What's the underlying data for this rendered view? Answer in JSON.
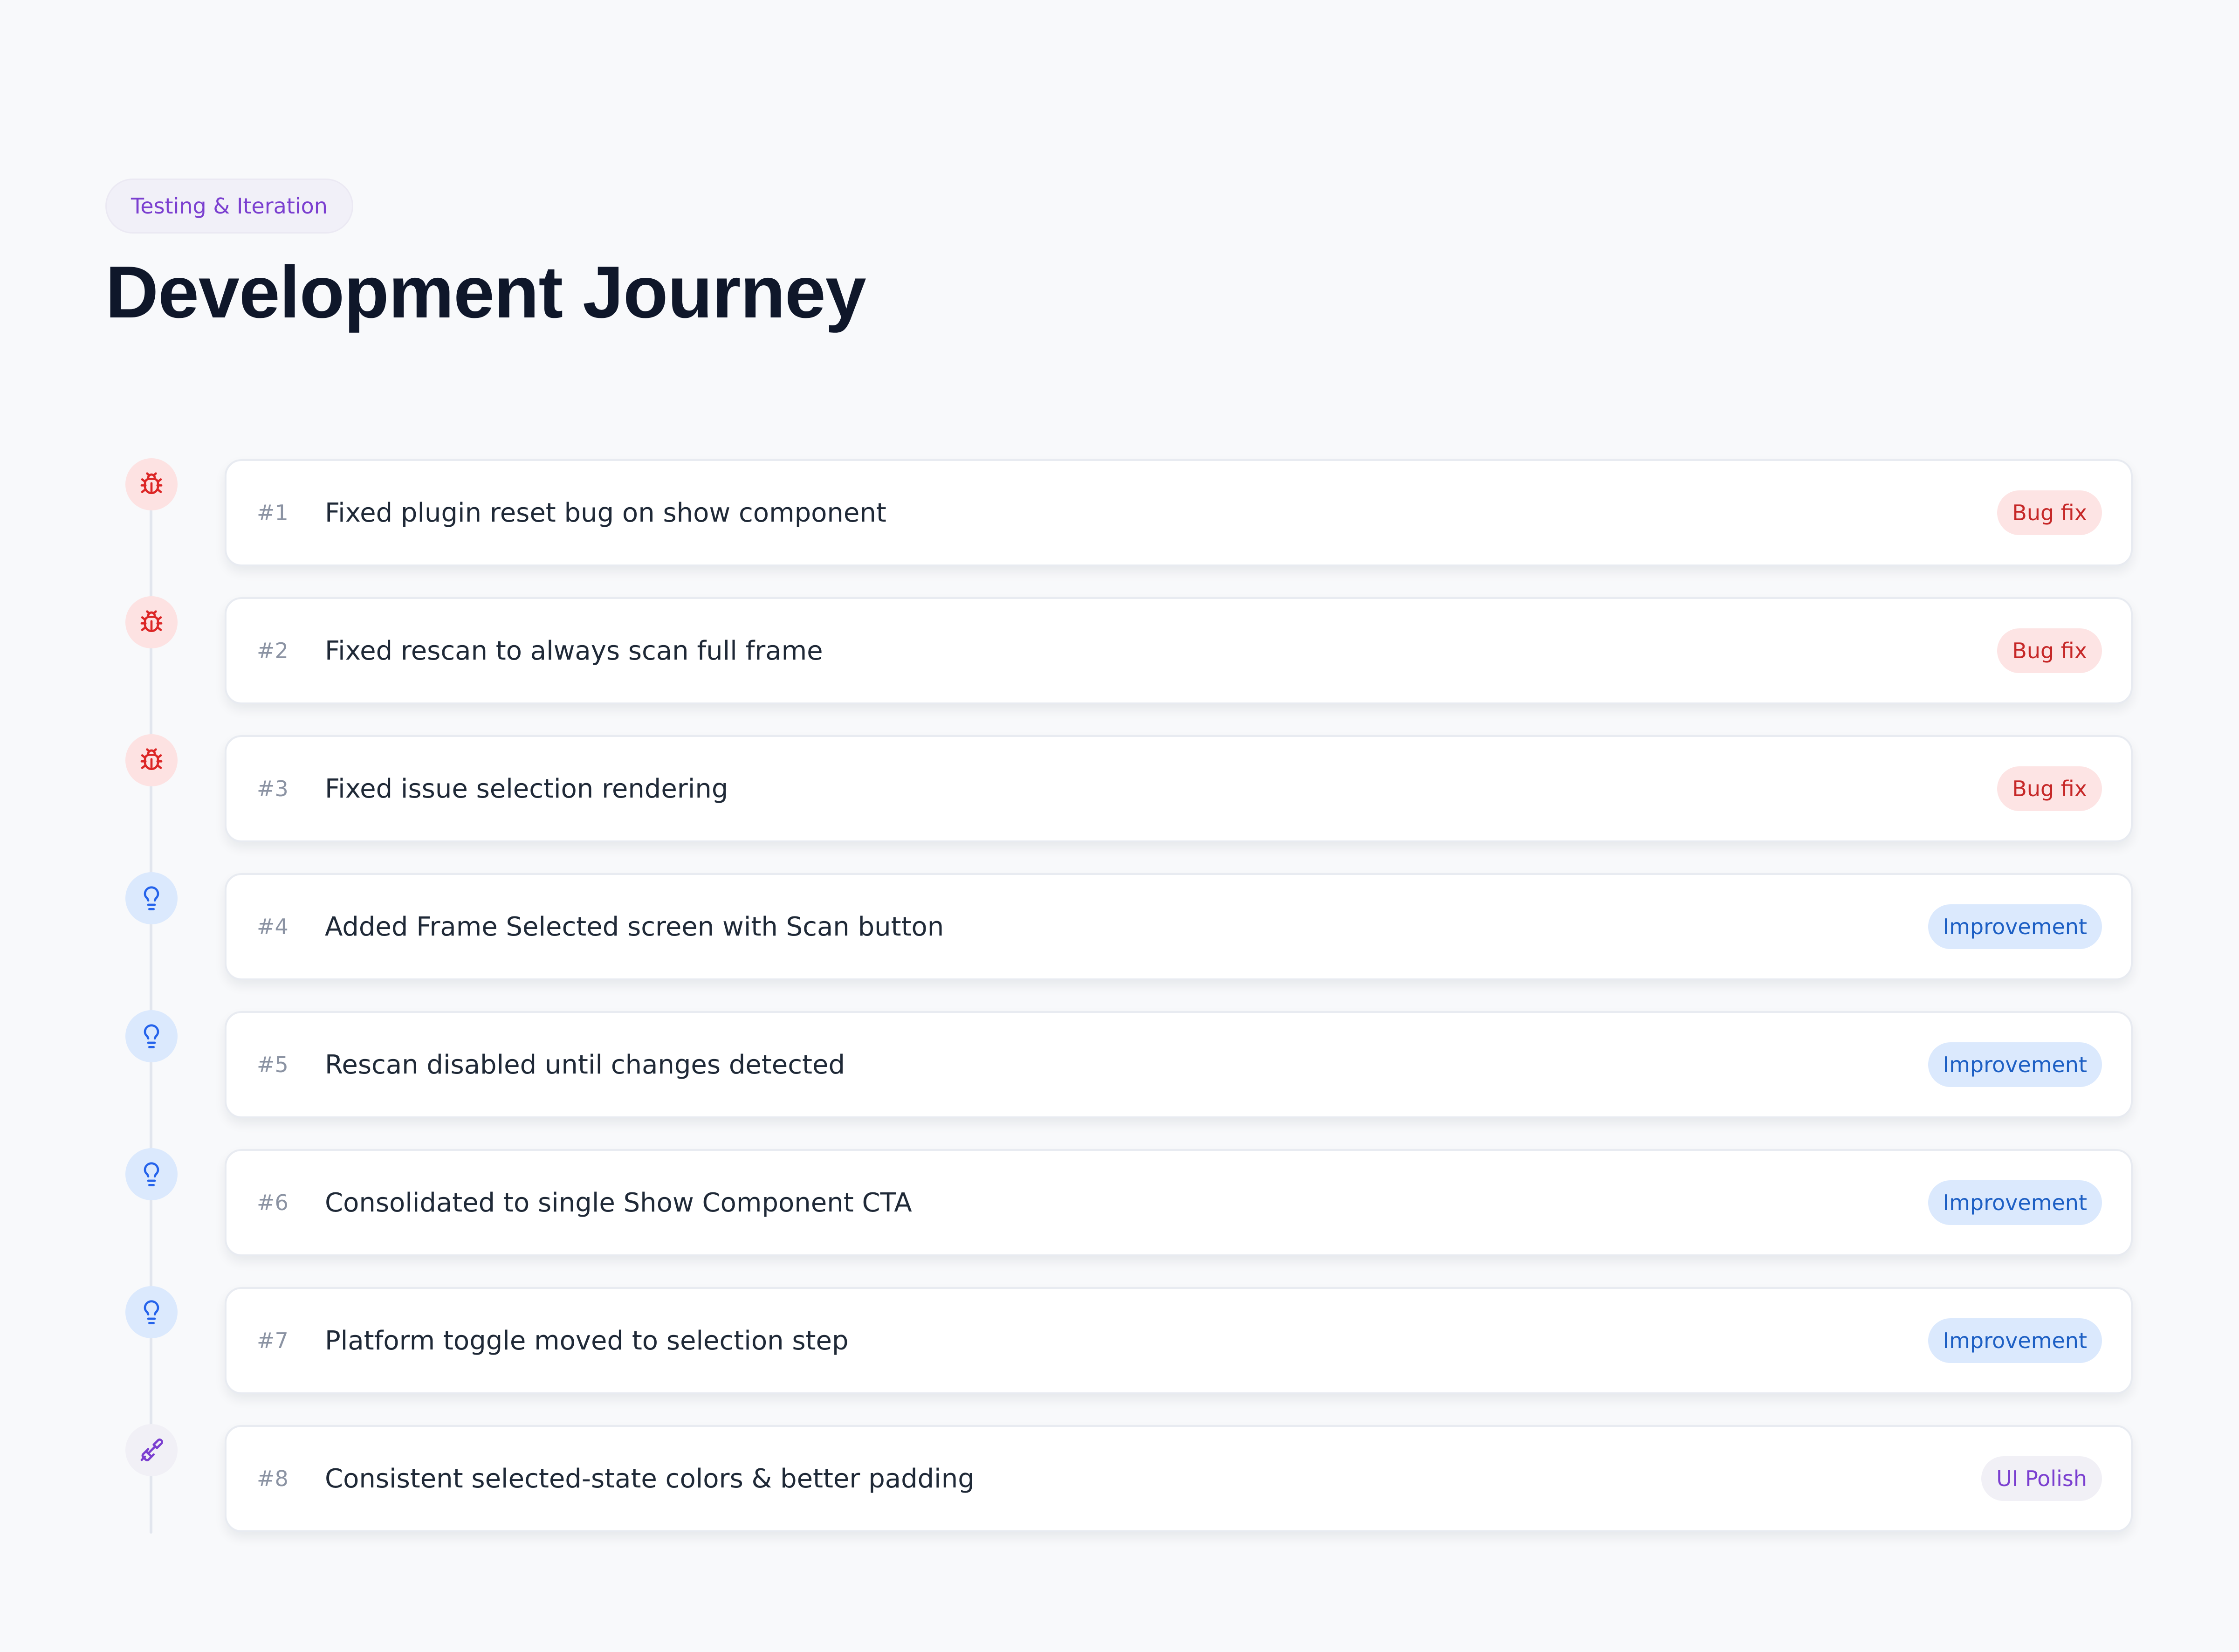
{
  "header": {
    "eyebrow": "Testing & Iteration",
    "title": "Development Journey"
  },
  "colors": {
    "bug": {
      "icon": "#dc2626",
      "icon_bg": "#fde2e2",
      "badge_bg": "#fde4e4",
      "badge_text": "#c62828"
    },
    "improvement": {
      "icon": "#2563eb",
      "icon_bg": "#dbe9fd",
      "badge_bg": "#dbe9fd",
      "badge_text": "#1d5fc4"
    },
    "polish": {
      "icon": "#7b3fd0",
      "icon_bg": "#f1f0f6",
      "badge_bg": "#f1f0f6",
      "badge_text": "#7b3fd0"
    }
  },
  "items": [
    {
      "number": "#1",
      "text": "Fixed plugin reset bug on show component",
      "badge": "Bug fix",
      "kind": "bug",
      "icon": "bug-icon"
    },
    {
      "number": "#2",
      "text": "Fixed rescan to always scan full frame",
      "badge": "Bug fix",
      "kind": "bug",
      "icon": "bug-icon"
    },
    {
      "number": "#3",
      "text": "Fixed issue selection rendering",
      "badge": "Bug fix",
      "kind": "bug",
      "icon": "bug-icon"
    },
    {
      "number": "#4",
      "text": "Added Frame Selected screen with Scan button",
      "badge": "Improvement",
      "kind": "improvement",
      "icon": "lightbulb-icon"
    },
    {
      "number": "#5",
      "text": "Rescan disabled until changes detected",
      "badge": "Improvement",
      "kind": "improvement",
      "icon": "lightbulb-icon"
    },
    {
      "number": "#6",
      "text": "Consolidated to single Show Component CTA",
      "badge": "Improvement",
      "kind": "improvement",
      "icon": "lightbulb-icon"
    },
    {
      "number": "#7",
      "text": "Platform toggle moved to selection step",
      "badge": "Improvement",
      "kind": "improvement",
      "icon": "lightbulb-icon"
    },
    {
      "number": "#8",
      "text": "Consistent selected-state colors & better padding",
      "badge": "UI Polish",
      "kind": "polish",
      "icon": "paintbrush-icon"
    }
  ]
}
